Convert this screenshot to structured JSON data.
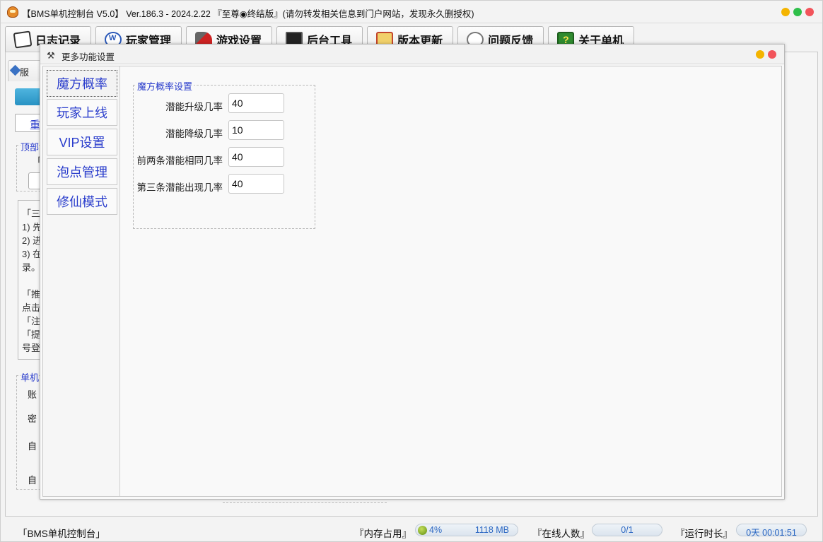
{
  "window": {
    "title": "【BMS单机控制台 V5.0】 Ver.186.3 - 2024.2.22 『至尊◉终结版』(请勿转发相关信息到门户网站，发现永久删授权)",
    "controls": [
      "minimize",
      "maximize",
      "close"
    ]
  },
  "main_tabs": [
    {
      "label": "日志记录",
      "icon": "notepad-icon"
    },
    {
      "label": "玩家管理",
      "icon": "players-icon"
    },
    {
      "label": "游戏设置",
      "icon": "cannon-icon"
    },
    {
      "label": "后台工具",
      "icon": "monitor-icon"
    },
    {
      "label": "版本更新",
      "icon": "scroll-icon"
    },
    {
      "label": "问题反馈",
      "icon": "feedback-icon"
    },
    {
      "label": "关于单机",
      "icon": "help-icon"
    }
  ],
  "background": {
    "subtab_label": "服",
    "button_label": "重",
    "group_title": "顶部",
    "group_text": "「",
    "text_lines": [
      "「三",
      "1) 先",
      "2) 进",
      "3) 在",
      "录。",
      "",
      "「推",
      "点击",
      "「注",
      "「提",
      "号登"
    ],
    "group2_title": "单机",
    "group2_labels": [
      "账",
      "密",
      "自",
      "自"
    ]
  },
  "dialog": {
    "title": "更多功能设置",
    "nav": [
      {
        "label": "魔方概率",
        "active": true
      },
      {
        "label": "玩家上线",
        "active": false
      },
      {
        "label": "VIP设置",
        "active": false
      },
      {
        "label": "泡点管理",
        "active": false
      },
      {
        "label": "修仙模式",
        "active": false
      }
    ],
    "group_title": "魔方概率设置",
    "fields": [
      {
        "label": "潜能升级几率",
        "value": "40"
      },
      {
        "label": "潜能降级几率",
        "value": "10"
      },
      {
        "label": "前两条潜能相同几率",
        "value": "40"
      },
      {
        "label": "第三条潜能出现几率",
        "value": "40"
      }
    ]
  },
  "status": {
    "app_name": "「BMS单机控制台」",
    "memory_label": "『内存占用』",
    "memory_percent": "4%",
    "memory_mb": "1118 MB",
    "online_label": "『在线人数』",
    "online_value": "0/1",
    "runtime_label": "『运行时长』",
    "runtime_value": "0天 00:01:51"
  },
  "colors": {
    "accent_blue": "#2a3dcc",
    "pill_text": "#2a66c2",
    "close_red": "#f2545b",
    "min_yellow": "#f4b400",
    "max_green": "#2fbf4a"
  }
}
